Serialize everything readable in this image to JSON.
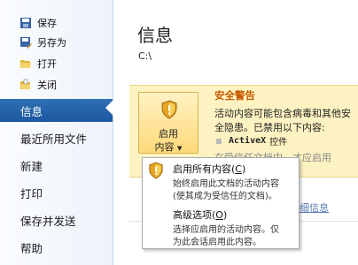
{
  "nav": {
    "quick_actions": [
      {
        "label": "保存",
        "icon": "save-icon"
      },
      {
        "label": "另存为",
        "icon": "save-as-icon"
      },
      {
        "label": "打开",
        "icon": "open-folder-icon"
      },
      {
        "label": "关闭",
        "icon": "close-file-icon"
      }
    ],
    "items": [
      {
        "label": "信息",
        "active": true
      },
      {
        "label": "最近所用文件",
        "active": false
      },
      {
        "label": "新建",
        "active": false
      },
      {
        "label": "打印",
        "active": false
      },
      {
        "label": "保存并发送",
        "active": false
      },
      {
        "label": "帮助",
        "active": false
      }
    ]
  },
  "main": {
    "title": "信息",
    "path": "C:\\"
  },
  "security": {
    "button_line1": "启用",
    "button_line2": "内容",
    "heading": "安全警告",
    "text_line1": "活动内容可能包含病毒和其他安",
    "text_line2": "全隐患。已禁用以下内容:",
    "activex_code": "ActiveX",
    "activex_rest": "控件",
    "obscured_line": "在受信任文档中，才应启用",
    "link_tail": "的详细信息"
  },
  "dropdown": {
    "items": [
      {
        "title": "启用所有内容",
        "mnemonic": "C",
        "desc1": "始终启用此文档的活动内容",
        "desc2": "(使其成为受信任的文档)。"
      },
      {
        "title": "高级选项",
        "mnemonic": "O",
        "desc1": "选择应启用的活动内容。仅",
        "desc2": "为此会话启用此内容。"
      }
    ]
  },
  "colors": {
    "accent": "#1d58a0",
    "warning_bg": "#fdf3c2",
    "warning_title": "#c65a00"
  }
}
